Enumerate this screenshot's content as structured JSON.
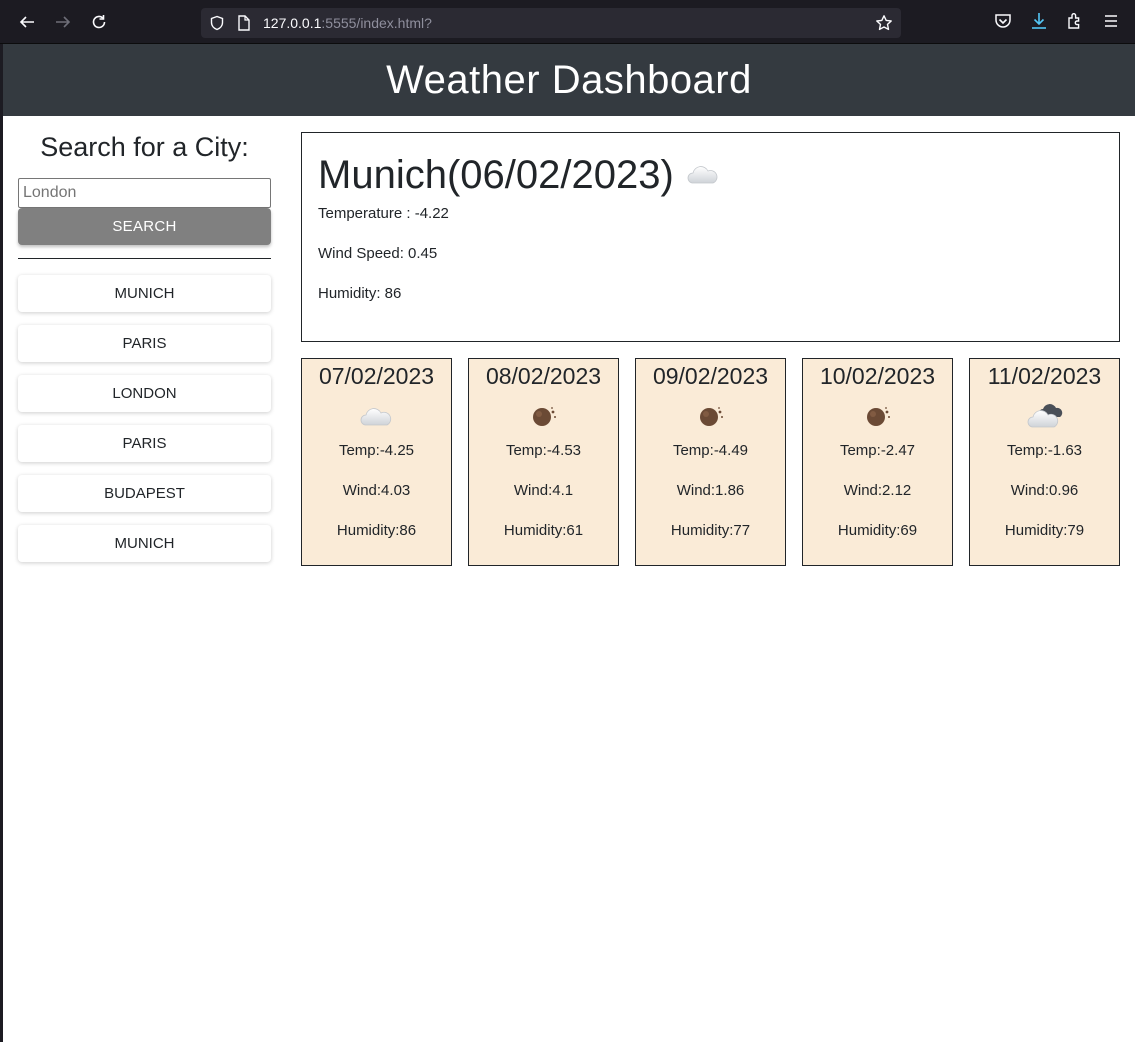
{
  "browser": {
    "url_host": "127.0.0.1",
    "url_rest": ":5555/index.html?"
  },
  "header": {
    "title": "Weather Dashboard"
  },
  "sidebar": {
    "heading": "Search for a City:",
    "search_placeholder": "London",
    "search_button": "SEARCH",
    "history": [
      "MUNICH",
      "PARIS",
      "LONDON",
      "PARIS",
      "BUDAPEST",
      "MUNICH"
    ]
  },
  "current": {
    "title": "Munich(06/02/2023)",
    "icon": "cloud-icon",
    "temperature": "Temperature : -4.22",
    "wind": "Wind Speed: 0.45",
    "humidity": "Humidity: 86"
  },
  "forecast": [
    {
      "date": "07/02/2023",
      "icon": "cloud-icon",
      "temp": "Temp:-4.25",
      "wind": "Wind:4.03",
      "humidity": "Humidity:86"
    },
    {
      "date": "08/02/2023",
      "icon": "night-icon",
      "temp": "Temp:-4.53",
      "wind": "Wind:4.1",
      "humidity": "Humidity:61"
    },
    {
      "date": "09/02/2023",
      "icon": "night-icon",
      "temp": "Temp:-4.49",
      "wind": "Wind:1.86",
      "humidity": "Humidity:77"
    },
    {
      "date": "10/02/2023",
      "icon": "night-icon",
      "temp": "Temp:-2.47",
      "wind": "Wind:2.12",
      "humidity": "Humidity:69"
    },
    {
      "date": "11/02/2023",
      "icon": "broken-clouds-icon",
      "temp": "Temp:-1.63",
      "wind": "Wind:0.96",
      "humidity": "Humidity:79"
    }
  ]
}
